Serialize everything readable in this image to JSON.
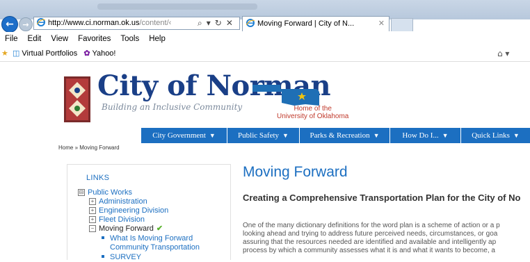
{
  "browser": {
    "address": {
      "host": "http://www.ci.norman.ok.us",
      "rest": "/content/‹",
      "actions": [
        "⌕",
        "▾",
        "↻",
        "✕"
      ]
    },
    "tab": {
      "title": "Moving Forward | City of N...",
      "close": "✕"
    },
    "menu": [
      "File",
      "Edit",
      "View",
      "Favorites",
      "Tools",
      "Help"
    ],
    "favorites": [
      "Virtual Portfolios",
      "Yahoo!"
    ],
    "toolbar_right": "⌂ ▾"
  },
  "site": {
    "title": "City of Norman",
    "tagline": "Building an Inclusive Community",
    "home_of": [
      "Home of the",
      "University of Oklahoma"
    ],
    "colors": {
      "brand_blue": "#1c6fc1",
      "title_blue": "#1a3f87",
      "accent_red": "#c0392b",
      "ok_blue": "#1f6fb5",
      "star": "#f1c40f"
    }
  },
  "nav": [
    {
      "label": "City Government"
    },
    {
      "label": "Public Safety"
    },
    {
      "label": "Parks & Recreation"
    },
    {
      "label": "How Do I..."
    },
    {
      "label": "Quick Links"
    }
  ],
  "nav_arrow": "▼",
  "breadcrumb": "Home » Moving Forward",
  "links": {
    "title": "LINKS",
    "items": [
      {
        "label": "Public Works",
        "marker": "⊟"
      },
      {
        "label": "Administration",
        "marker": "+"
      },
      {
        "label": "Engineering Division",
        "marker": "+"
      },
      {
        "label": "Fleet Division",
        "marker": "+"
      },
      {
        "label": "Moving Forward",
        "marker": "−",
        "check": "✔"
      },
      {
        "label": "What Is Moving Forward"
      },
      {
        "label": "Community Transportation"
      },
      {
        "label": "SURVEY"
      }
    ]
  },
  "main": {
    "title": "Moving Forward",
    "subtitle": "Creating a Comprehensive Transportation Plan for the City of No",
    "paragraph": [
      "One of the many dictionary definitions for the word plan is a scheme of action or a p",
      "looking ahead and trying to address future perceived needs, circumstances, or goa",
      "assuring that the resources needed are identified and available and intelligently ap",
      "process by which a community assesses what it is and what it wants to become, a"
    ]
  }
}
